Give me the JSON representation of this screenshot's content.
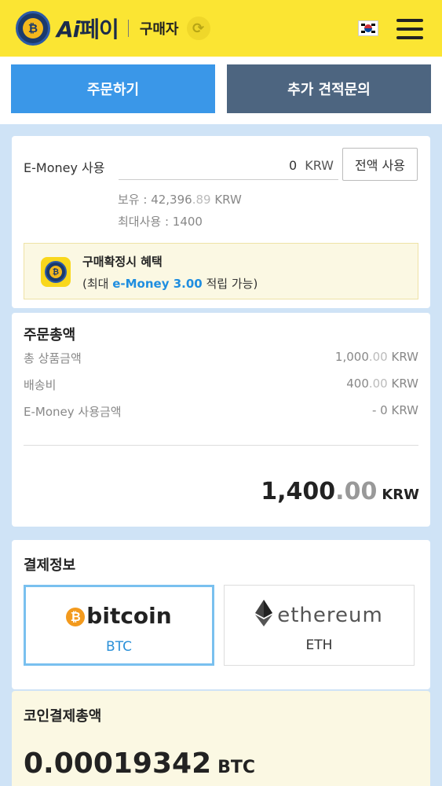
{
  "header": {
    "brand_ai": "Ai",
    "brand_pay": "페이",
    "role": "구매자",
    "colors": {
      "bg": "#fbe533",
      "brand": "#1b2b4b"
    },
    "icons": [
      "coin-logo-icon",
      "refresh-icon",
      "korea-flag-icon",
      "hamburger-menu-icon"
    ]
  },
  "tabs": {
    "order": "주문하기",
    "quote": "추가 견적문의"
  },
  "emoney": {
    "label": "E-Money 사용",
    "amount": "0",
    "unit": "KRW",
    "use_all": "전액 사용",
    "hold_label": "보유 : 42,396",
    "hold_decimal": ".89",
    "hold_unit": " KRW",
    "max": "최대사용 : 1400",
    "benefit_title": "구매확정시 혜택",
    "benefit_prefix": "(최대 ",
    "benefit_highlight": "e-Money 3.00",
    "benefit_suffix": " 적립 가능)"
  },
  "summary": {
    "title": "주문총액",
    "rows": [
      {
        "label": "총 상품금액",
        "value": "1,000",
        "decimal": ".00",
        "unit": " KRW"
      },
      {
        "label": "배송비",
        "value": "400",
        "decimal": ".00",
        "unit": " KRW"
      },
      {
        "label": "E-Money 사용금액",
        "value": "- 0",
        "decimal": "",
        "unit": " KRW"
      }
    ],
    "total_int": "1,400",
    "total_dec": ".00",
    "total_unit": "KRW"
  },
  "payment": {
    "title": "결제정보",
    "btc_logo": "bitcoin",
    "btc_code": "BTC",
    "eth_logo": "ethereum",
    "eth_code": "ETH",
    "selected": "BTC"
  },
  "coin_total": {
    "title": "코인결제총액",
    "amount": "0.00019342",
    "unit": "BTC"
  }
}
